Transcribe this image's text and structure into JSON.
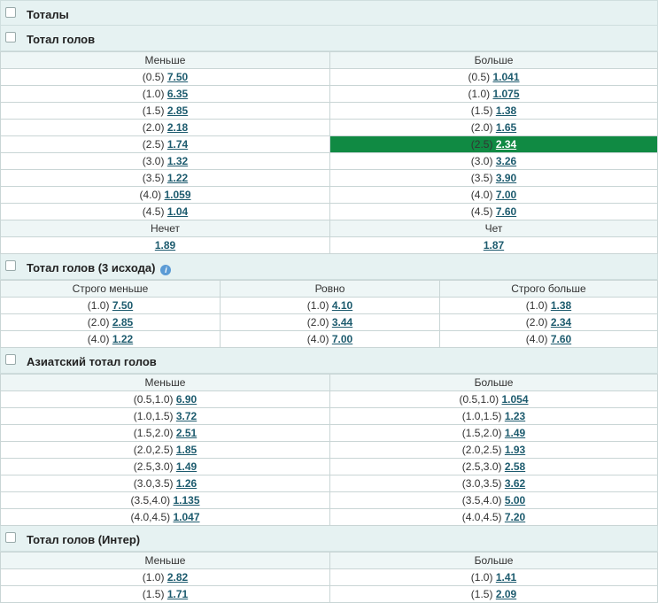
{
  "section_main": {
    "title": "Тоталы"
  },
  "total_goals": {
    "title": "Тотал голов",
    "col_under": "Меньше",
    "col_over": "Больше",
    "rows": [
      {
        "line": "(0.5)",
        "under": "7.50",
        "over": "1.041"
      },
      {
        "line": "(1.0)",
        "under": "6.35",
        "over": "1.075"
      },
      {
        "line": "(1.5)",
        "under": "2.85",
        "over": "1.38"
      },
      {
        "line": "(2.0)",
        "under": "2.18",
        "over": "1.65"
      },
      {
        "line": "(2.5)",
        "under": "1.74",
        "over": "2.34"
      },
      {
        "line": "(3.0)",
        "under": "1.32",
        "over": "3.26"
      },
      {
        "line": "(3.5)",
        "under": "1.22",
        "over": "3.90"
      },
      {
        "line": "(4.0)",
        "under": "1.059",
        "over": "7.00"
      },
      {
        "line": "(4.5)",
        "under": "1.04",
        "over": "7.60"
      }
    ],
    "odd_label": "Нечет",
    "even_label": "Чет",
    "odd_value": "1.89",
    "even_value": "1.87"
  },
  "total_goals_3way": {
    "title": "Тотал голов (3 исхода)",
    "info_icon": "i",
    "col_under": "Строго меньше",
    "col_exact": "Ровно",
    "col_over": "Строго больше",
    "rows": [
      {
        "line": "(1.0)",
        "under": "7.50",
        "exact": "4.10",
        "over": "1.38"
      },
      {
        "line": "(2.0)",
        "under": "2.85",
        "exact": "3.44",
        "over": "2.34"
      },
      {
        "line": "(4.0)",
        "under": "1.22",
        "exact": "7.00",
        "over": "7.60"
      }
    ]
  },
  "asian_total": {
    "title": "Азиатский тотал голов",
    "col_under": "Меньше",
    "col_over": "Больше",
    "rows": [
      {
        "line": "(0.5,1.0)",
        "under": "6.90",
        "over": "1.054"
      },
      {
        "line": "(1.0,1.5)",
        "under": "3.72",
        "over": "1.23"
      },
      {
        "line": "(1.5,2.0)",
        "under": "2.51",
        "over": "1.49"
      },
      {
        "line": "(2.0,2.5)",
        "under": "1.85",
        "over": "1.93"
      },
      {
        "line": "(2.5,3.0)",
        "under": "1.49",
        "over": "2.58"
      },
      {
        "line": "(3.0,3.5)",
        "under": "1.26",
        "over": "3.62"
      },
      {
        "line": "(3.5,4.0)",
        "under": "1.135",
        "over": "5.00"
      },
      {
        "line": "(4.0,4.5)",
        "under": "1.047",
        "over": "7.20"
      }
    ]
  },
  "total_goals_inter": {
    "title": "Тотал голов (Интер)",
    "col_under": "Меньше",
    "col_over": "Больше",
    "rows": [
      {
        "line": "(1.0)",
        "under": "2.82",
        "over": "1.41"
      },
      {
        "line": "(1.5)",
        "under": "1.71",
        "over": "2.09"
      }
    ]
  },
  "colors": {
    "selected": "#108a43",
    "odds_link": "#1d5b6e",
    "header_bg": "#e6f2f2"
  }
}
